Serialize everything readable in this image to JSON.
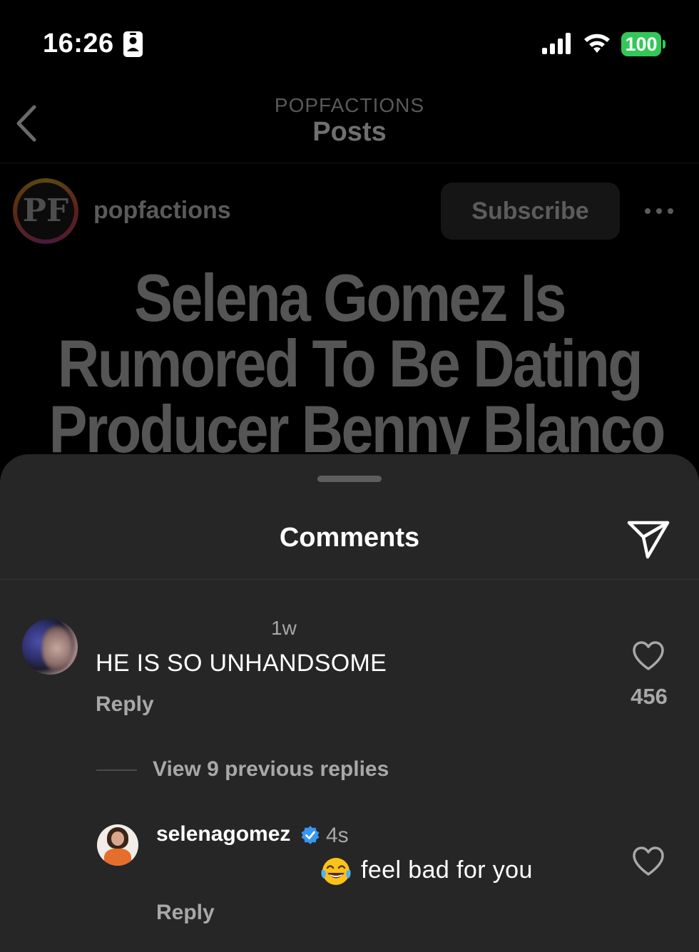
{
  "status_bar": {
    "time": "16:26",
    "battery": "100",
    "icons": [
      "contact-card-icon",
      "signal-icon",
      "wifi-icon",
      "battery-icon"
    ],
    "battery_color": "#33c759"
  },
  "nav": {
    "subtitle": "POPFACTIONS",
    "title": "Posts",
    "back_icon": "chevron-left-icon"
  },
  "post": {
    "avatar_monogram": "PF",
    "username": "popfactions",
    "subscribe_label": "Subscribe",
    "more_icon": "more-horizontal-icon",
    "headline_lines": [
      "Selena Gomez Is",
      "Rumored To Be Dating",
      "Producer Benny Blanco"
    ]
  },
  "comments_sheet": {
    "title": "Comments",
    "share_icon": "send-icon",
    "comment": {
      "time": "1w",
      "text": "HE IS SO UNHANDSOME",
      "reply_label": "Reply",
      "like_icon": "heart-icon",
      "like_count": "456"
    },
    "view_replies": "View 9 previous replies",
    "reply": {
      "username": "selenagomez",
      "verified_icon": "verified-badge-icon",
      "verified_color": "#3897f0",
      "time": "4s",
      "emoji_icon": "tears-of-joy-emoji-icon",
      "text": "feel bad for you",
      "reply_label": "Reply",
      "like_icon": "heart-icon"
    }
  }
}
